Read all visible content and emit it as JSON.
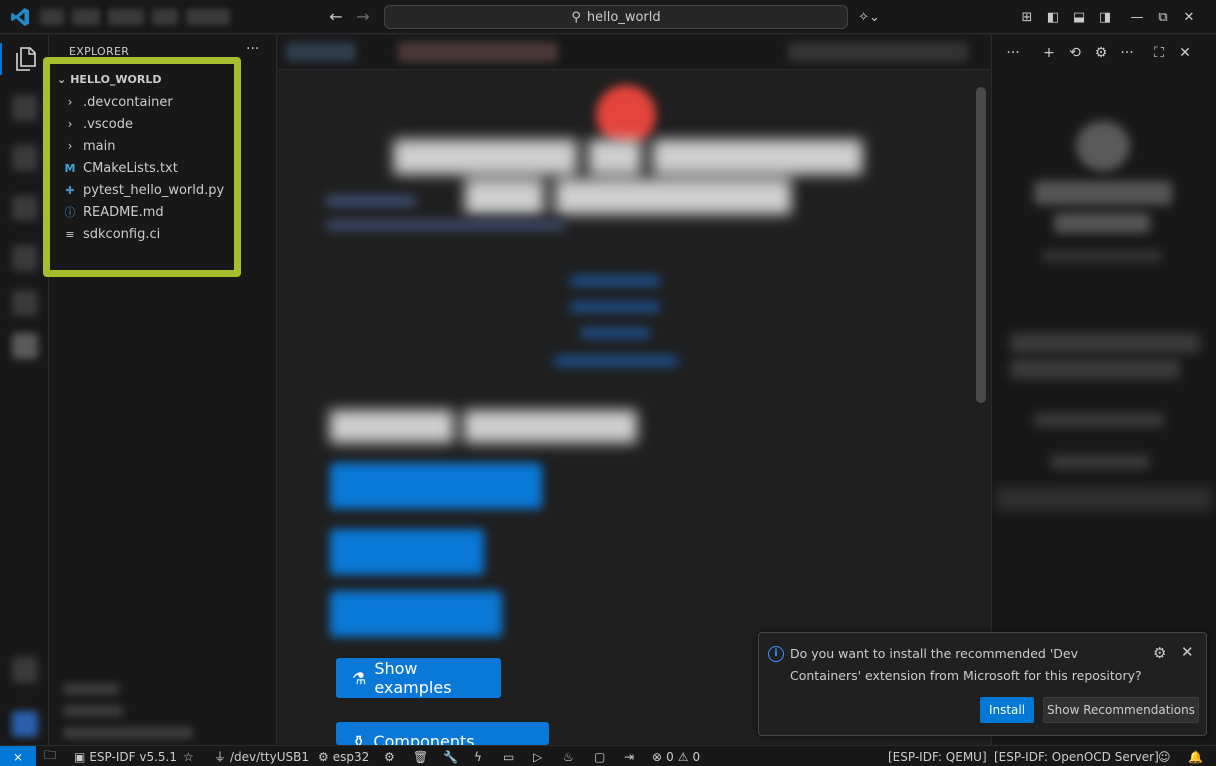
{
  "titlebar": {
    "search_text": "hello_world",
    "search_icon": "search-icon"
  },
  "explorer": {
    "header": "EXPLORER",
    "folder": "HELLO_WORLD",
    "items": [
      {
        "label": ".devcontainer",
        "icon": "chevron-right-icon"
      },
      {
        "label": ".vscode",
        "icon": "chevron-right-icon"
      },
      {
        "label": "main",
        "icon": "chevron-right-icon"
      },
      {
        "label": "CMakeLists.txt",
        "icon": "cmake-file-icon"
      },
      {
        "label": "pytest_hello_world.py",
        "icon": "python-file-icon"
      },
      {
        "label": "README.md",
        "icon": "info-file-icon"
      },
      {
        "label": "sdkconfig.ci",
        "icon": "text-file-icon"
      }
    ],
    "highlight_color": "#a6bd2e"
  },
  "editor": {
    "buttons": {
      "show_examples": "Show examples",
      "components_manager": "Components manager"
    },
    "accent": "#0a78d6"
  },
  "notification": {
    "message": "Do you want to install the recommended 'Dev Containers' extension from Microsoft for this repository?",
    "install": "Install",
    "show_recommendations": "Show Recommendations"
  },
  "statusbar": {
    "idf_version": "ESP-IDF v5.5.1",
    "port": "/dev/ttyUSB1",
    "target": "esp32",
    "errors": "0",
    "warnings": "0",
    "qemu": "[ESP-IDF: QEMU]",
    "openocd": "[ESP-IDF: OpenOCD Server]"
  }
}
